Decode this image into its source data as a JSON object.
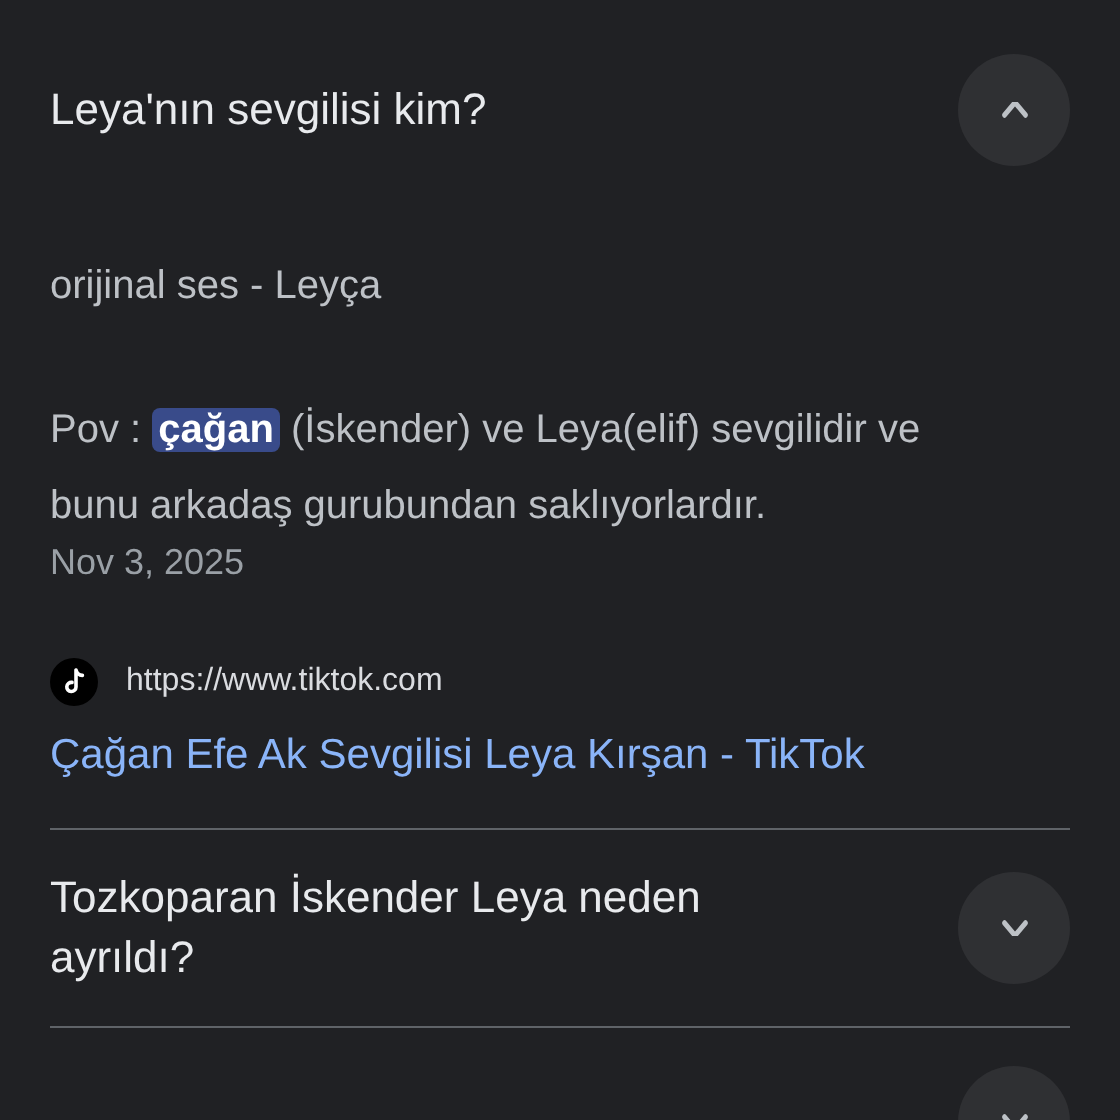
{
  "questions": [
    {
      "question": "Leya'nın sevgilisi kim?",
      "expanded": true,
      "answer": {
        "source_title": "orijinal ses - Leyça",
        "snippet": {
          "before": "Pov :",
          "highlight": "çağan",
          "after": "(İskender) ve Leya(elif) sevgilidir ve bunu arkadaş gurubundan saklıyorlardır."
        },
        "date": "Nov 3, 2025",
        "url": "https://www.tiktok.com",
        "link": "Çağan Efe Ak Sevgilisi Leya Kırşan - TikTok"
      }
    },
    {
      "question": "Tozkoparan İskender Leya neden ayrıldı?",
      "expanded": false
    },
    {
      "expanded": false
    }
  ]
}
